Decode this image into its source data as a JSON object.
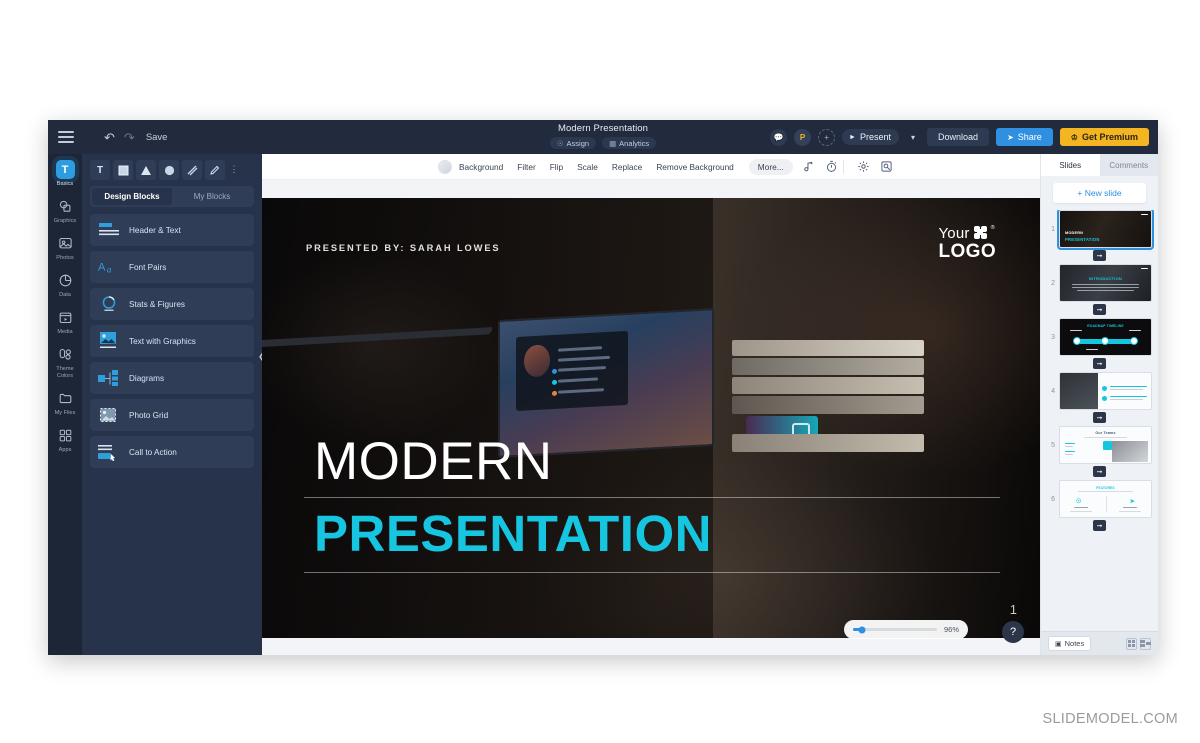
{
  "app": {
    "topbar": {
      "menu_icon": "hamburger-icon",
      "undo_icon": "undo-arrow-icon",
      "redo_icon": "redo-arrow-icon",
      "save_label": "Save",
      "doc_title": "Modern Presentation",
      "assign_label": "Assign",
      "assign_icon": "user-circle-icon",
      "analytics_label": "Analytics",
      "analytics_icon": "chart-icon",
      "comment_icon": "comment-icon",
      "avatar_initial": "P",
      "add_collaborator_icon": "plus-icon",
      "present_label": "Present",
      "present_play_icon": "play-icon",
      "present_caret_icon": "chevron-down-icon",
      "download_label": "Download",
      "share_label": "Share",
      "share_icon": "share-arrow-icon",
      "premium_label": "Get Premium",
      "premium_icon": "crown-icon"
    },
    "rail": {
      "items": [
        {
          "label": "Basics",
          "icon": "text-tool-icon"
        },
        {
          "label": "Graphics",
          "icon": "shapes-icon"
        },
        {
          "label": "Photos",
          "icon": "image-icon"
        },
        {
          "label": "Data",
          "icon": "pie-chart-icon"
        },
        {
          "label": "Media",
          "icon": "video-icon"
        },
        {
          "label": "Theme Colors",
          "icon": "palette-icon"
        },
        {
          "label": "My Files",
          "icon": "folder-icon"
        },
        {
          "label": "Apps",
          "icon": "apps-grid-icon"
        }
      ]
    },
    "panel": {
      "tools": [
        {
          "name": "text-tool",
          "glyph": "T"
        },
        {
          "name": "square-tool",
          "glyph": "square"
        },
        {
          "name": "triangle-tool",
          "glyph": "triangle"
        },
        {
          "name": "circle-tool",
          "glyph": "circle"
        },
        {
          "name": "line-tool",
          "glyph": "line"
        },
        {
          "name": "pen-tool",
          "glyph": "pen"
        },
        {
          "name": "more-tools",
          "glyph": "dots"
        }
      ],
      "tabs": [
        {
          "label": "Design Blocks",
          "active": true
        },
        {
          "label": "My Blocks",
          "active": false
        }
      ],
      "blocks": [
        {
          "label": "Header & Text",
          "icon": "header-text-icon"
        },
        {
          "label": "Font Pairs",
          "icon": "font-pairs-icon"
        },
        {
          "label": "Stats & Figures",
          "icon": "stats-donut-icon"
        },
        {
          "label": "Text with Graphics",
          "icon": "text-graphics-icon"
        },
        {
          "label": "Diagrams",
          "icon": "diagram-icon"
        },
        {
          "label": "Photo Grid",
          "icon": "photo-grid-icon"
        },
        {
          "label": "Call to Action",
          "icon": "call-to-action-icon"
        }
      ],
      "collapse_icon": "chevron-left-icon"
    },
    "context_toolbar": {
      "swatch": "color-swatch",
      "items": [
        "Background",
        "Filter",
        "Flip",
        "Scale",
        "Replace",
        "Remove Background"
      ],
      "more_label": "More...",
      "icons": [
        "music-add-icon",
        "timer-icon",
        "gear-icon",
        "crop-scan-icon"
      ]
    },
    "slide": {
      "presented_by": "PRESENTED BY: SARAH LOWES",
      "logo_line1": "Your",
      "logo_reg": "®",
      "logo_line2": "LOGO",
      "title_top": "MODERN",
      "title_bottom": "PRESENTATION",
      "accent_color": "#16c5e0"
    },
    "canvas_controls": {
      "zoom_value": "96%",
      "slide_number": "1",
      "help_label": "?"
    },
    "slides_panel": {
      "tabs": [
        {
          "label": "Slides",
          "active": true
        },
        {
          "label": "Comments",
          "active": false
        }
      ],
      "new_slide_label": "+ New slide",
      "thumbnails": [
        {
          "number": "1",
          "title": "MODERN",
          "subtitle": "PRESENTATION",
          "style": "dark-photo",
          "selected": true
        },
        {
          "number": "2",
          "title": "INTRODUCTION",
          "subtitle": "",
          "style": "dark-photo",
          "selected": false
        },
        {
          "number": "3",
          "title": "ROADMAP TIMELINE",
          "subtitle": "",
          "style": "black",
          "selected": false
        },
        {
          "number": "4",
          "title": "",
          "subtitle": "",
          "style": "split-white",
          "selected": false
        },
        {
          "number": "5",
          "title": "Our Teams",
          "subtitle": "",
          "style": "white-photo",
          "selected": false
        },
        {
          "number": "6",
          "title": "FEATURES",
          "subtitle": "",
          "style": "white-icons",
          "selected": false
        }
      ],
      "transition_icon": "transition-arrow-icon",
      "notes_label": "Notes",
      "notes_icon": "notes-icon",
      "grid_view_icon": "grid-view-icon",
      "list_view_icon": "list-view-icon"
    }
  },
  "watermark": "SLIDEMODEL.COM"
}
